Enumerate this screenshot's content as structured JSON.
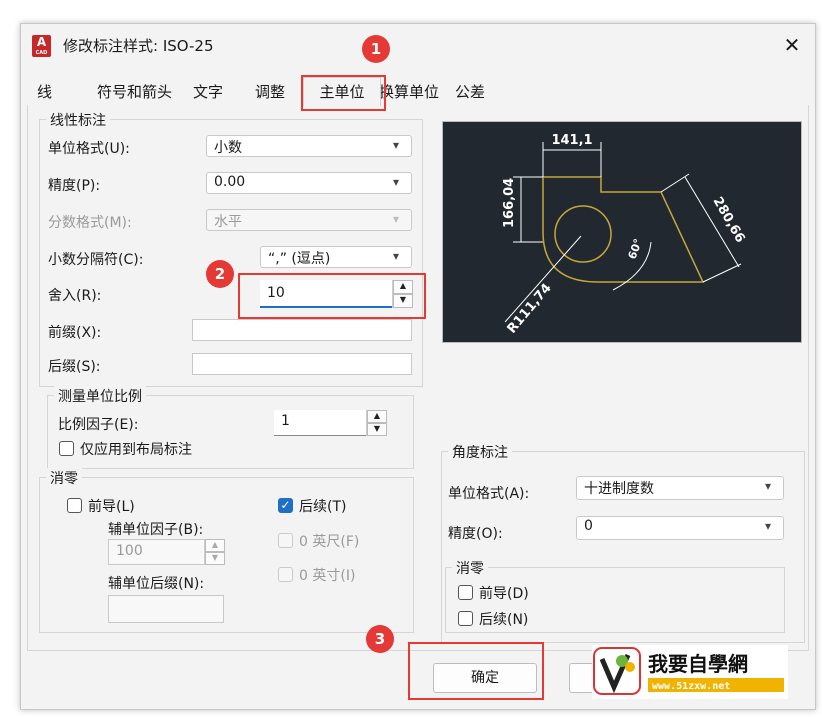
{
  "dialog": {
    "title": "修改标注样式: ISO-25",
    "close": "✕",
    "app_icon_letter": "A",
    "app_icon_sub": "CAD"
  },
  "tabs": [
    "线",
    "符号和箭头",
    "文字",
    "调整",
    "主单位",
    "换算单位",
    "公差"
  ],
  "active_tab": "主单位",
  "linear": {
    "group": "线性标注",
    "unit_format_label": "单位格式(U):",
    "unit_format_value": "小数",
    "precision_label": "精度(P):",
    "precision_value": "0.00",
    "fraction_label": "分数格式(M):",
    "fraction_value": "水平",
    "decimal_sep_label": "小数分隔符(C):",
    "decimal_sep_value": "“,” (逗点)",
    "round_label": "舍入(R):",
    "round_value": "10",
    "prefix_label": "前缀(X):",
    "suffix_label": "后缀(S):"
  },
  "scale": {
    "group": "测量单位比例",
    "factor_label": "比例因子(E):",
    "factor_value": "1",
    "layout_only_label": "仅应用到布局标注"
  },
  "zero": {
    "group": "消零",
    "leading_label": "前导(L)",
    "trailing_label": "后续(T)",
    "sub_factor_label": "辅单位因子(B):",
    "sub_factor_value": "100",
    "sub_suffix_label": "辅单位后缀(N):",
    "feet_label": "0 英尺(F)",
    "inch_label": "0 英寸(I)"
  },
  "angular": {
    "group": "角度标注",
    "unit_format_label": "单位格式(A):",
    "unit_format_value": "十进制度数",
    "precision_label": "精度(O):",
    "precision_value": "0",
    "zero_group": "消零",
    "leading_label": "前导(D)",
    "trailing_label": "后续(N)"
  },
  "preview": {
    "dim_top": "141,1",
    "dim_left": "166,04",
    "dim_diag": "280,66",
    "dim_angle": "60°",
    "dim_radius": "R111,74"
  },
  "buttons": {
    "ok": "确定"
  },
  "badges": [
    "1",
    "2",
    "3"
  ],
  "watermark": {
    "brand": "我要自學網",
    "url": "www.51zxw.net"
  },
  "colors": {
    "highlight": "#e53935",
    "check": "#1f6fc5",
    "preview_bg": "#212830",
    "shape": "#c6a63a"
  }
}
